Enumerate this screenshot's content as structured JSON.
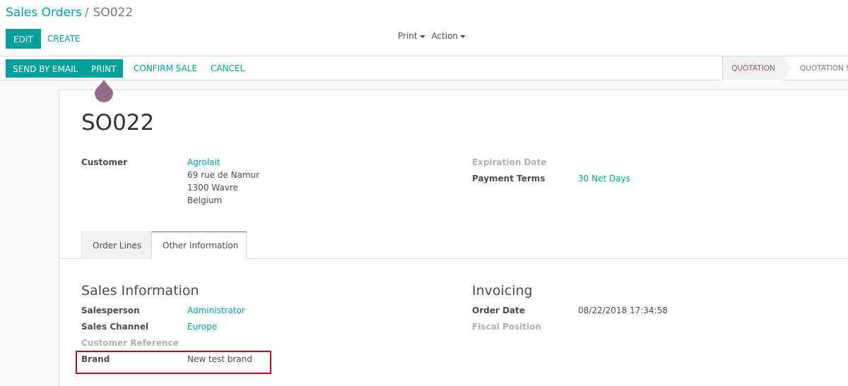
{
  "breadcrumb": {
    "parent": "Sales Orders",
    "separator": "/",
    "current": "SO022"
  },
  "buttons": {
    "edit": "EDIT",
    "create": "CREATE"
  },
  "dropdowns": {
    "print": "Print",
    "action": "Action"
  },
  "statusbar": {
    "send_by_email": "SEND BY EMAIL",
    "print": "PRINT",
    "confirm_sale": "CONFIRM SALE",
    "cancel": "CANCEL",
    "stages": {
      "active": "QUOTATION",
      "next": "QUOTATION SENT"
    }
  },
  "colors": {
    "primary": "#00a09d",
    "accent": "#875a7b",
    "highlight": "#d0021b"
  },
  "record": {
    "name": "SO022",
    "customer_label": "Customer",
    "customer_name": "Agrolait",
    "address_line1": "69 rue de Namur",
    "address_line2": "1300 Wavre",
    "address_line3": "Belgium",
    "expiration_label": "Expiration Date",
    "payment_terms_label": "Payment Terms",
    "payment_terms_value": "30 Net Days"
  },
  "tabs": [
    {
      "label": "Order Lines"
    },
    {
      "label": "Other Information"
    }
  ],
  "sales_info": {
    "title": "Sales Information",
    "salesperson_label": "Salesperson",
    "salesperson_value": "Administrator",
    "channel_label": "Sales Channel",
    "channel_value": "Europe",
    "customer_ref_label": "Customer Reference",
    "brand_label": "Brand",
    "brand_value": "New test brand"
  },
  "invoicing": {
    "title": "Invoicing",
    "order_date_label": "Order Date",
    "order_date_value": "08/22/2018 17:34:58",
    "fiscal_position_label": "Fiscal Position"
  }
}
